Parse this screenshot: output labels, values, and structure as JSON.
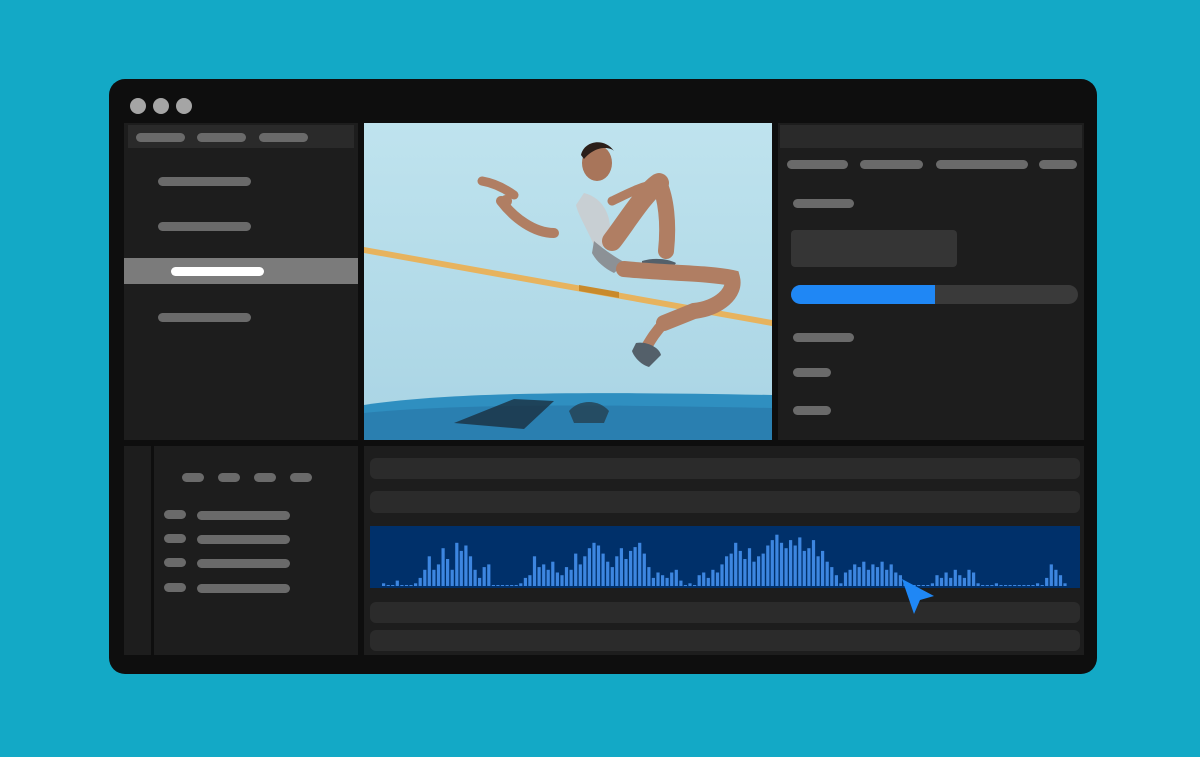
{
  "window": {
    "controls": [
      "window-dot-1",
      "window-dot-2",
      "window-dot-3"
    ],
    "dot_color": "#a5a5a5"
  },
  "colors": {
    "background": "#13a9c6",
    "accent": "#1f87f5",
    "waveform": "#3d86e0",
    "waveform_bg": "#00306a"
  },
  "sidebar": {
    "tabs": [
      "tab-1",
      "tab-2",
      "tab-3"
    ],
    "items": [
      "item-1",
      "item-2",
      "item-3",
      "item-4"
    ],
    "active_index": 2
  },
  "preview": {
    "media": "high-jump-athlete-photo"
  },
  "inspector": {
    "progress_fraction": 0.5
  },
  "timeline": {
    "track_count": 5,
    "audio_track_index": 2,
    "waveform_levels": [
      0.05,
      0.0,
      0.0,
      0.1,
      0.0,
      0.0,
      0.0,
      0.05,
      0.15,
      0.3,
      0.55,
      0.3,
      0.4,
      0.7,
      0.5,
      0.3,
      0.8,
      0.65,
      0.75,
      0.55,
      0.3,
      0.15,
      0.35,
      0.4,
      0.0,
      0.0,
      0.0,
      0.0,
      0.0,
      0.0,
      0.05,
      0.15,
      0.2,
      0.55,
      0.35,
      0.4,
      0.3,
      0.45,
      0.25,
      0.2,
      0.35,
      0.3,
      0.6,
      0.4,
      0.55,
      0.7,
      0.8,
      0.75,
      0.6,
      0.45,
      0.35,
      0.55,
      0.7,
      0.5,
      0.65,
      0.72,
      0.8,
      0.6,
      0.35,
      0.15,
      0.25,
      0.2,
      0.15,
      0.25,
      0.3,
      0.1,
      0.0,
      0.05,
      0.0,
      0.2,
      0.25,
      0.15,
      0.3,
      0.25,
      0.4,
      0.55,
      0.6,
      0.8,
      0.65,
      0.5,
      0.7,
      0.45,
      0.55,
      0.6,
      0.75,
      0.85,
      0.95,
      0.8,
      0.7,
      0.85,
      0.75,
      0.9,
      0.65,
      0.7,
      0.85,
      0.55,
      0.65,
      0.45,
      0.35,
      0.2,
      0.05,
      0.25,
      0.3,
      0.4,
      0.35,
      0.45,
      0.3,
      0.4,
      0.35,
      0.45,
      0.3,
      0.4,
      0.25,
      0.2,
      0.05,
      0.0,
      0.0,
      0.0,
      0.0,
      0.0,
      0.05,
      0.2,
      0.15,
      0.25,
      0.15,
      0.3,
      0.2,
      0.15,
      0.3,
      0.25,
      0.05,
      0.0,
      0.0,
      0.0,
      0.05,
      0.0,
      0.0,
      0.0,
      0.0,
      0.0,
      0.0,
      0.0,
      0.0,
      0.05,
      0.0,
      0.15,
      0.4,
      0.3,
      0.2,
      0.05
    ]
  },
  "cursor": {
    "icon": "pointer-arrow-icon"
  }
}
